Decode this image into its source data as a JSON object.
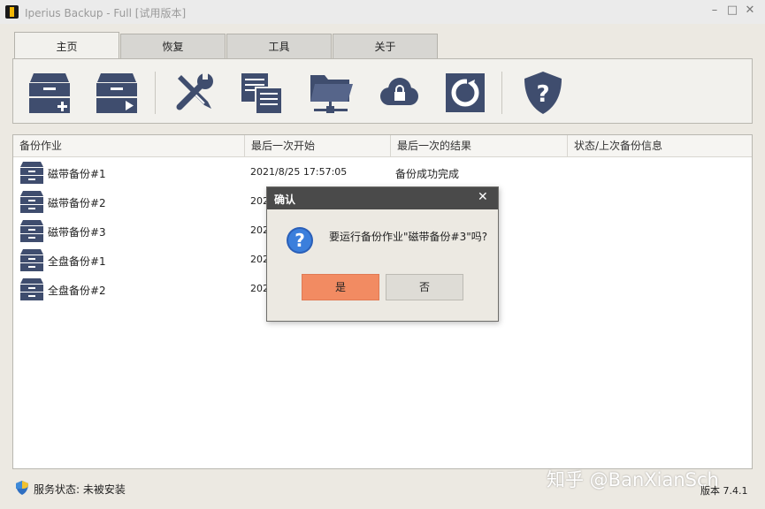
{
  "window": {
    "title": "Iperius Backup - Full [试用版本]",
    "controls": {
      "minimize": "–",
      "maximize": "□",
      "close": "✕"
    }
  },
  "tabs": [
    {
      "label": "主页",
      "active": true
    },
    {
      "label": "恢复",
      "active": false
    },
    {
      "label": "工具",
      "active": false
    },
    {
      "label": "关于",
      "active": false
    }
  ],
  "ribbon": {
    "icons": [
      "new-backup-icon",
      "run-backup-icon",
      "tools-icon",
      "log-icon",
      "network-folder-icon",
      "cloud-lock-icon",
      "refresh-icon",
      "help-shield-icon"
    ]
  },
  "table": {
    "columns": [
      "备份作业",
      "最后一次开始",
      "最后一次的结果",
      "状态/上次备份信息"
    ],
    "rows": [
      {
        "name": "磁带备份#1",
        "last_start": "2021/8/25 17:57:05",
        "result": "备份成功完成",
        "status": ""
      },
      {
        "name": "磁带备份#2",
        "last_start": "202",
        "result": "",
        "status": ""
      },
      {
        "name": "磁带备份#3",
        "last_start": "202",
        "result": "",
        "status": ""
      },
      {
        "name": "全盘备份#1",
        "last_start": "202",
        "result": "",
        "status": ""
      },
      {
        "name": "全盘备份#2",
        "last_start": "202",
        "result": "",
        "status": ""
      }
    ]
  },
  "statusbar": {
    "service_status": "服务状态: 未被安装",
    "version": "版本 7.4.1",
    "watermark": "知乎 @BanXianSch"
  },
  "dialog": {
    "title": "确认",
    "close": "✕",
    "message": "要运行备份作业\"磁带备份#3\"吗?",
    "yes_label": "是",
    "no_label": "否"
  },
  "colors": {
    "accent_button": "#f28b62",
    "icon_navy": "#3f4d6e",
    "dialog_titlebar": "#4a4a4a"
  }
}
